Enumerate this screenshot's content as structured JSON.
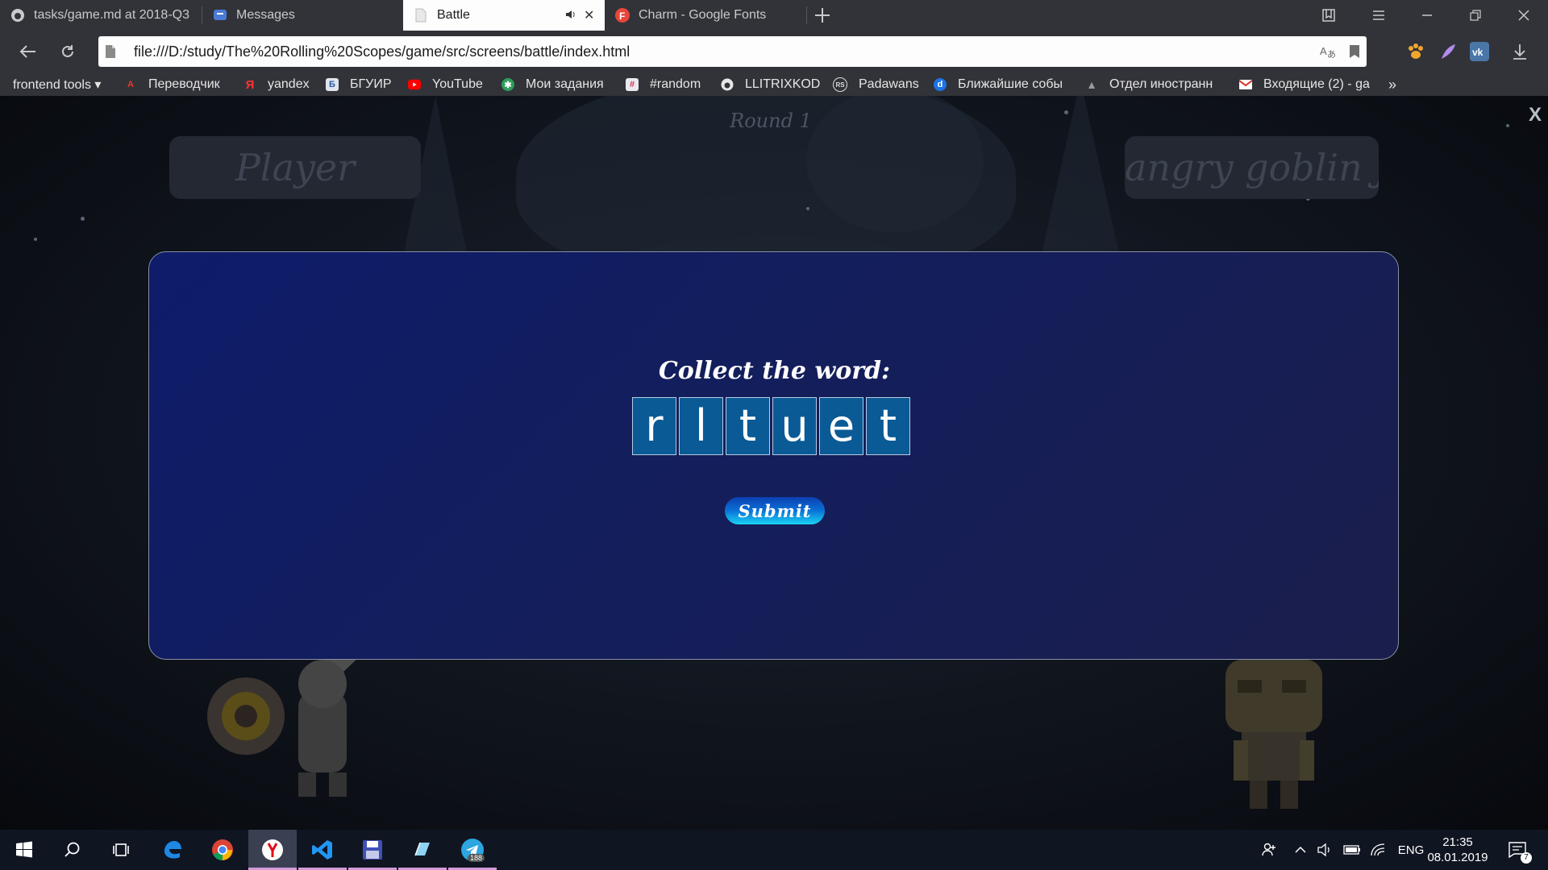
{
  "browser": {
    "tabs": [
      {
        "title": "tasks/game.md at 2018-Q3",
        "icon": "github-icon"
      },
      {
        "title": "Messages",
        "icon": "messages-icon"
      },
      {
        "title": "Battle",
        "icon": "page-icon",
        "active": true
      },
      {
        "title": "Charm - Google Fonts",
        "icon": "google-fonts-icon"
      }
    ],
    "url": "file:///D:/study/The%20Rolling%20Scopes/game/src/screens/battle/index.html",
    "bookmarks": [
      {
        "label": "frontend tools ▾",
        "icon": "folder-icon"
      },
      {
        "label": "Переводчик",
        "icon": "translate-icon"
      },
      {
        "label": "yandex",
        "icon": "yandex-icon"
      },
      {
        "label": "БГУИР",
        "icon": "bsuir-icon"
      },
      {
        "label": "YouTube",
        "icon": "youtube-icon"
      },
      {
        "label": "Мои задания",
        "icon": "tasks-icon"
      },
      {
        "label": "#random",
        "icon": "slack-icon"
      },
      {
        "label": "LLITRIXKOD",
        "icon": "github-icon"
      },
      {
        "label": "Padawans",
        "icon": "rs-icon"
      },
      {
        "label": "Ближайшие собы",
        "icon": "d-icon"
      },
      {
        "label": "Отдел иностранн",
        "icon": "hat-icon"
      },
      {
        "label": "Входящие (2) - ga",
        "icon": "gmail-icon"
      }
    ]
  },
  "game": {
    "round": "Round 1",
    "player_name": "Player",
    "enemy_name": "angry goblin Jon",
    "prompt": "Collect the word:",
    "letters": [
      "r",
      "l",
      "t",
      "u",
      "e",
      "t"
    ],
    "submit_label": "Submit",
    "close_label": "X"
  },
  "taskbar": {
    "apps": [
      "start",
      "search",
      "task-view",
      "edge",
      "chrome",
      "yandex-browser",
      "vscode",
      "save",
      "notes",
      "telegram"
    ],
    "telegram_badge": "188",
    "language": "ENG",
    "time": "21:35",
    "date": "08.01.2019",
    "notifications": "7"
  }
}
